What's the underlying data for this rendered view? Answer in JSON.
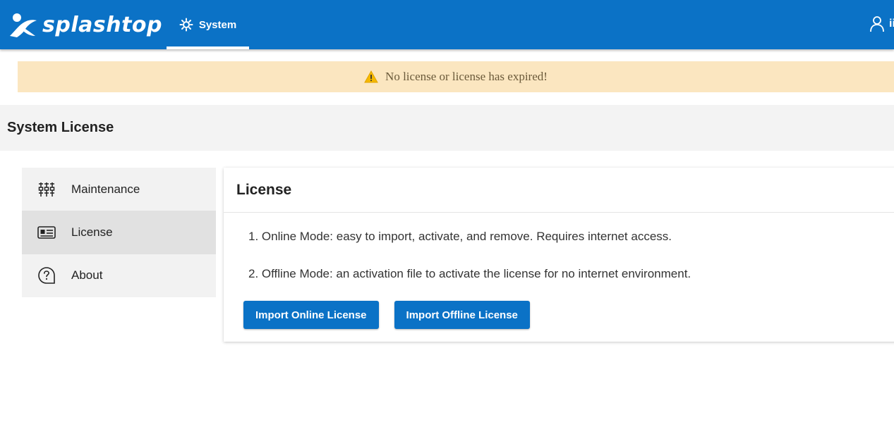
{
  "header": {
    "logo_text": "splashtop",
    "nav_tab_label": "System",
    "user_name": "ii"
  },
  "alert": {
    "message": "No license or license has expired!"
  },
  "page": {
    "title": "System License"
  },
  "sidebar": {
    "items": [
      {
        "label": "Maintenance",
        "icon": "equalizer-icon"
      },
      {
        "label": "License",
        "icon": "id-card-icon"
      },
      {
        "label": "About",
        "icon": "help-icon"
      }
    ],
    "active_index": 1
  },
  "card": {
    "title": "License",
    "lines": [
      "1. Online Mode: easy to import, activate, and remove. Requires internet access.",
      "2. Offline Mode: an activation file to activate the license for no internet environment."
    ],
    "buttons": {
      "online": "Import Online License",
      "offline": "Import Offline License"
    }
  },
  "colors": {
    "brand_blue": "#0b72c6",
    "alert_bg": "#fbe6c0",
    "warning_yellow": "#f5b800"
  }
}
